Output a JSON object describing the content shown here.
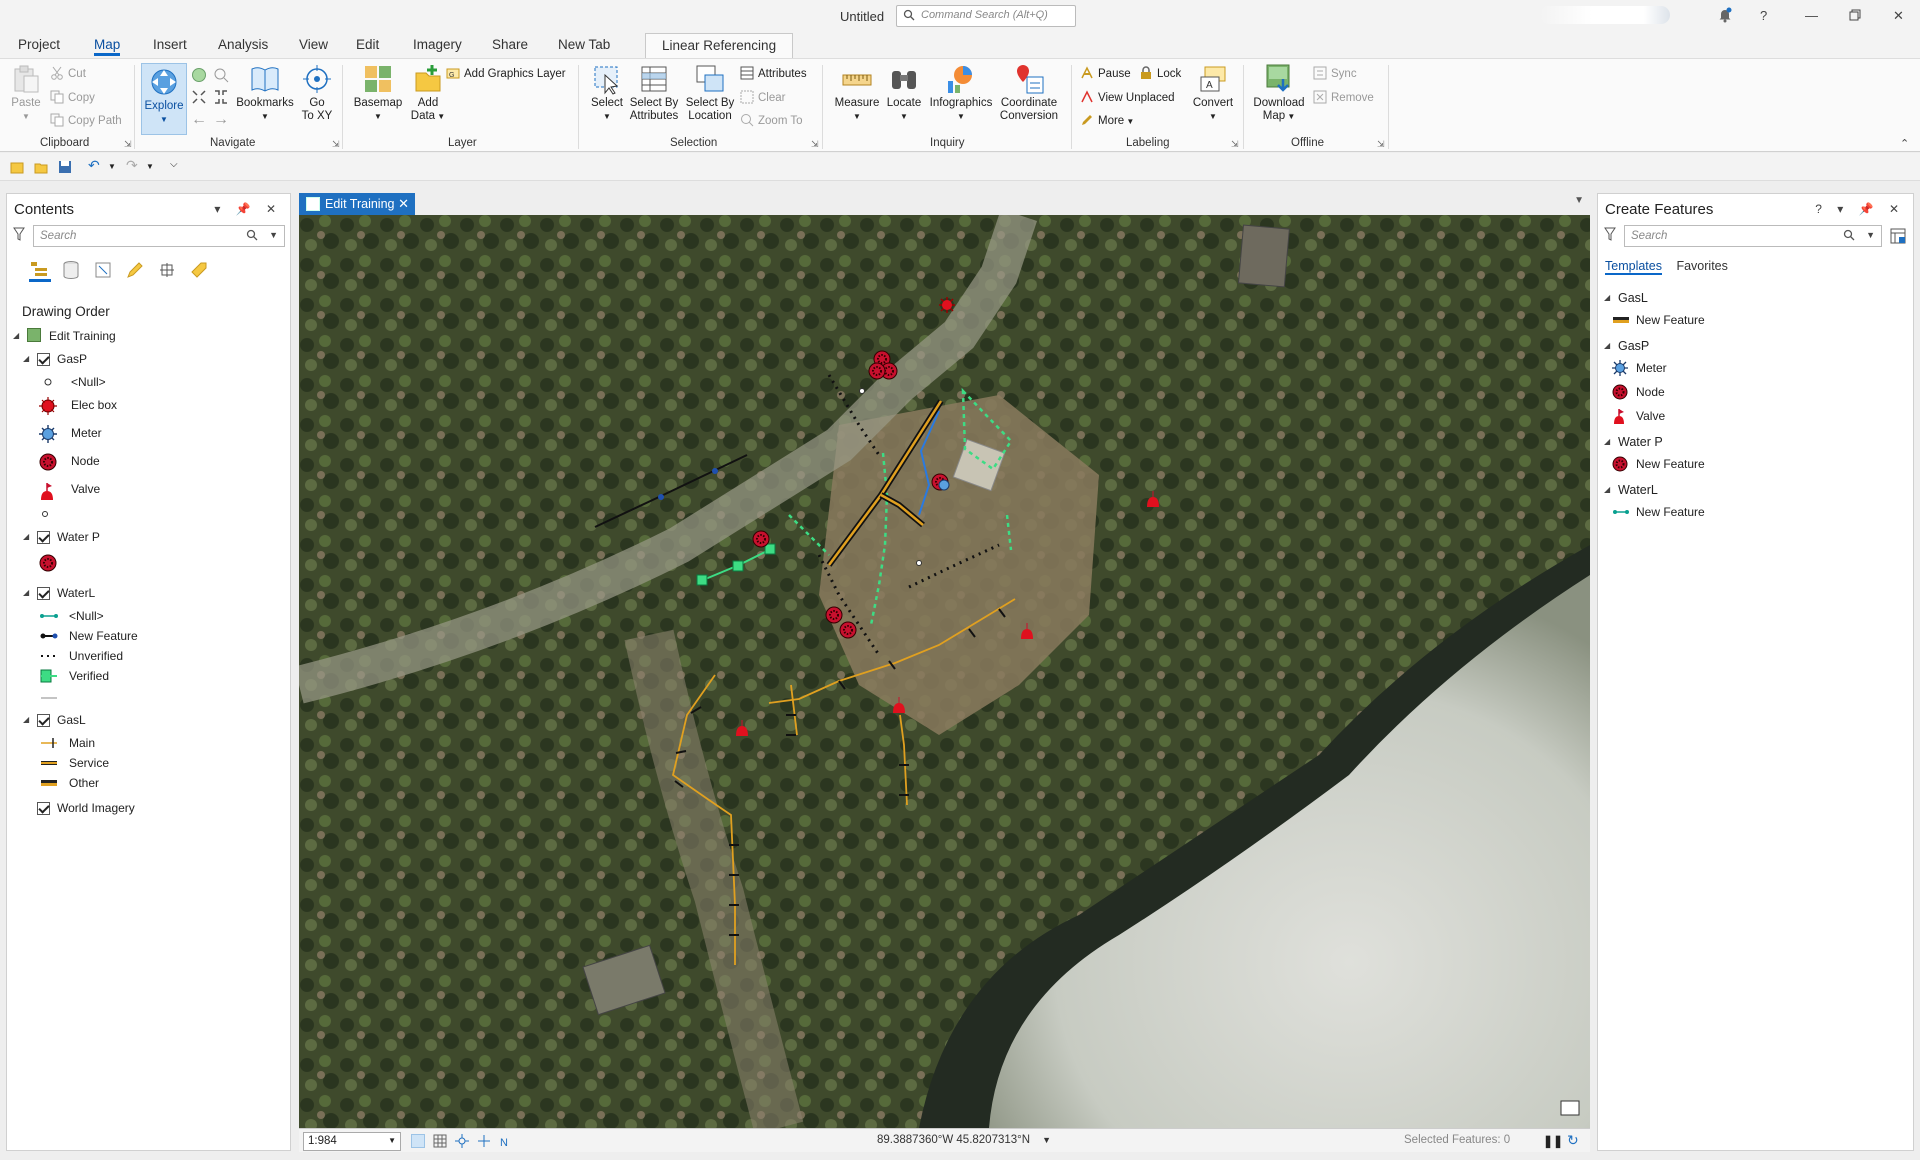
{
  "window": {
    "title": "Untitled",
    "command_search_placeholder": "Command Search (Alt+Q)"
  },
  "menu_tabs": [
    "Project",
    "Map",
    "Insert",
    "Analysis",
    "View",
    "Edit",
    "Imagery",
    "Share",
    "New Tab",
    "Linear Referencing"
  ],
  "active_tab": "Map",
  "ribbon": {
    "clipboard": {
      "label": "Clipboard",
      "paste": "Paste",
      "cut": "Cut",
      "copy": "Copy",
      "copy_path": "Copy Path"
    },
    "navigate": {
      "label": "Navigate",
      "explore": "Explore",
      "bookmarks": "Bookmarks",
      "go_to_xy_line1": "Go",
      "go_to_xy_line2": "To XY"
    },
    "layer": {
      "label": "Layer",
      "basemap": "Basemap",
      "add_data_line1": "Add",
      "add_data_line2": "Data",
      "add_graphics_layer": "Add Graphics Layer"
    },
    "selection": {
      "label": "Selection",
      "select": "Select",
      "select_by_attributes_line1": "Select By",
      "select_by_attributes_line2": "Attributes",
      "select_by_location_line1": "Select By",
      "select_by_location_line2": "Location",
      "attributes": "Attributes",
      "clear": "Clear",
      "zoom_to": "Zoom To"
    },
    "inquiry": {
      "label": "Inquiry",
      "measure": "Measure",
      "locate": "Locate",
      "infographics": "Infographics",
      "coordinate_conversion_line1": "Coordinate",
      "coordinate_conversion_line2": "Conversion"
    },
    "labeling": {
      "label": "Labeling",
      "pause": "Pause",
      "lock": "Lock",
      "view_unplaced": "View Unplaced",
      "more": "More",
      "convert": "Convert"
    },
    "offline": {
      "label": "Offline",
      "download_map_line1": "Download",
      "download_map_line2": "Map",
      "sync": "Sync",
      "remove": "Remove"
    }
  },
  "contents": {
    "title": "Contents",
    "search_placeholder": "Search",
    "drawing_order": "Drawing Order",
    "map_name": "Edit Training",
    "layers": {
      "gasp": {
        "name": "GasP",
        "items": [
          "<Null>",
          "Elec box",
          "Meter",
          "Node",
          "Valve"
        ]
      },
      "waterp": {
        "name": "Water P"
      },
      "waterl": {
        "name": "WaterL",
        "items": [
          "<Null>",
          "New Feature",
          "Unverified",
          "Verified"
        ]
      },
      "gasl": {
        "name": "GasL",
        "items": [
          "Main",
          "Service",
          "Other"
        ]
      },
      "basemap": {
        "name": "World Imagery"
      }
    }
  },
  "map_view": {
    "tab_label": "Edit Training",
    "scale": "1:984",
    "coordinates": "89.3887360°W 45.8207313°N",
    "selected_features": "Selected Features: 0"
  },
  "create_features": {
    "title": "Create Features",
    "search_placeholder": "Search",
    "tabs": [
      "Templates",
      "Favorites"
    ],
    "groups": {
      "gasl": {
        "name": "GasL",
        "items": [
          "New Feature"
        ]
      },
      "gasp": {
        "name": "GasP",
        "items": [
          "Meter",
          "Node",
          "Valve"
        ]
      },
      "waterp": {
        "name": "Water P",
        "items": [
          "New Feature"
        ]
      },
      "waterl": {
        "name": "WaterL",
        "items": [
          "New Feature"
        ]
      }
    }
  },
  "colors": {
    "accent": "#0a67c8",
    "tab_blue": "#1f70c1",
    "gas_main": "#e0a020",
    "node_red": "#c8102e",
    "verified_green": "#3ddc84"
  }
}
